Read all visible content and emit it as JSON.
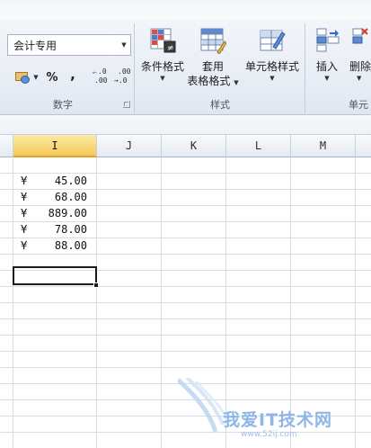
{
  "ribbon": {
    "number_group": {
      "format_value": "会计专用",
      "percent_label": "%",
      "comma_label": ",",
      "increase_decimal_top": ".0",
      "increase_decimal_bottom": ".00",
      "decrease_decimal_top": ".00",
      "decrease_decimal_bottom": "→.0",
      "group_label": "数字"
    },
    "styles_group": {
      "conditional_format_label": "条件格式",
      "table_format_line1": "套用",
      "table_format_line2": "表格格式",
      "cell_styles_label": "单元格样式",
      "group_label": "样式"
    },
    "cells_group": {
      "insert_label": "插入",
      "delete_label": "删除",
      "group_label": "单元"
    }
  },
  "grid": {
    "columns": [
      "I",
      "J",
      "K",
      "L",
      "M"
    ],
    "active_column": "I",
    "cells": [
      {
        "symbol": "¥",
        "value": "45.00"
      },
      {
        "symbol": "¥",
        "value": "68.00"
      },
      {
        "symbol": "¥",
        "value": "889.00"
      },
      {
        "symbol": "¥",
        "value": "78.00"
      },
      {
        "symbol": "¥",
        "value": "88.00"
      }
    ]
  },
  "watermark": {
    "text": "我爱IT技术网",
    "url": "www.52ij.com"
  },
  "colors": {
    "ribbon_bg": "#e6ecf4",
    "active_header": "#f5c95a",
    "gridline": "#d9dee6",
    "watermark": "#8fb6e6"
  }
}
